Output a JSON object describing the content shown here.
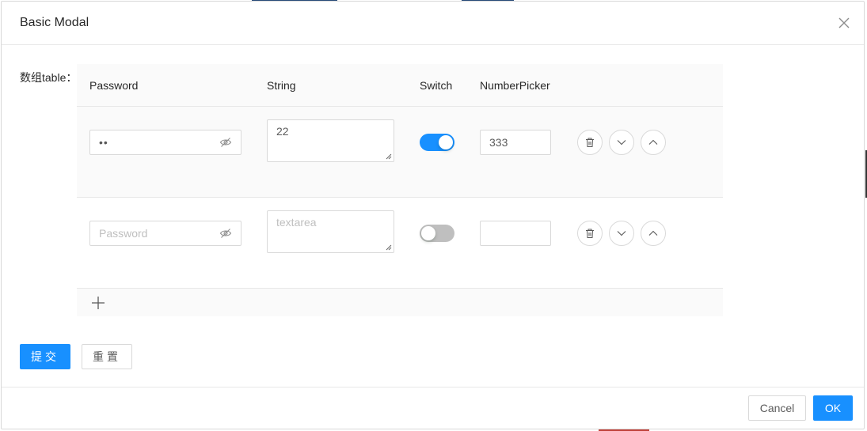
{
  "modal": {
    "title": "Basic Modal"
  },
  "form": {
    "label": "数组table："
  },
  "table": {
    "columns": [
      "Password",
      "String",
      "Switch",
      "NumberPicker"
    ],
    "rows": [
      {
        "password_value": "••",
        "password_placeholder": "",
        "string_value": "22",
        "string_placeholder": "",
        "switch_on": true,
        "number_value": "333"
      },
      {
        "password_value": "",
        "password_placeholder": "Password",
        "string_value": "",
        "string_placeholder": "textarea",
        "switch_on": false,
        "number_value": ""
      }
    ]
  },
  "buttons": {
    "submit": "提交",
    "reset": "重置",
    "cancel": "Cancel",
    "ok": "OK"
  },
  "icons": {
    "close": "close-icon",
    "eye": "eye-invisible-icon",
    "delete": "delete-icon",
    "move_down": "chevron-down-icon",
    "move_up": "chevron-up-icon",
    "add": "plus-icon"
  },
  "colors": {
    "primary": "#1890ff",
    "border": "#d9d9d9",
    "header_bg": "#fafafa"
  }
}
